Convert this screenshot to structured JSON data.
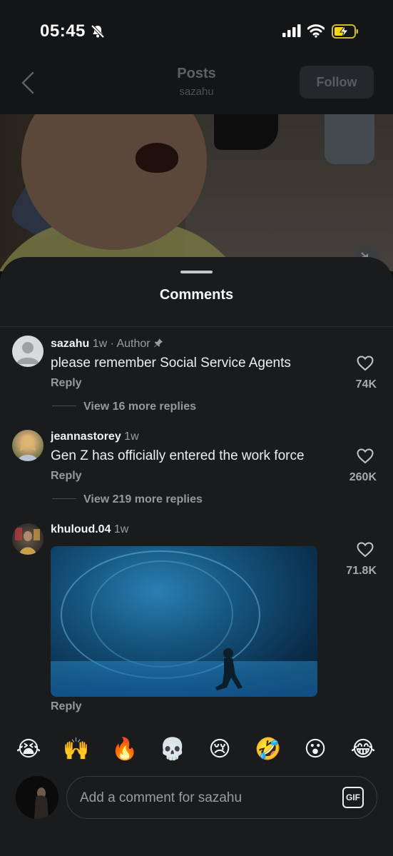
{
  "status_bar": {
    "time": "05:45"
  },
  "header": {
    "title": "Posts",
    "subtitle": "sazahu",
    "follow_label": "Follow"
  },
  "sheet": {
    "title": "Comments"
  },
  "comments": [
    {
      "username": "sazahu",
      "meta": " 1w · Author",
      "pinned": true,
      "text": "please remember Social Service Agents",
      "reply_label": "Reply",
      "view_replies": "View 16 more replies",
      "likes": "74K"
    },
    {
      "username": "jeannastorey",
      "meta": " 1w",
      "text": "Gen Z has officially entered the work force",
      "reply_label": "Reply",
      "view_replies": "View 219 more replies",
      "likes": "260K"
    },
    {
      "username": "khuloud.04",
      "meta": " 1w",
      "media": "gif-underwater-diver",
      "reply_label": "Reply",
      "likes": "71.8K"
    }
  ],
  "emojis": [
    "😭",
    "🙌",
    "🔥",
    "💀",
    "😢",
    "🤣",
    "😮",
    "😂"
  ],
  "composer": {
    "placeholder": "Add a comment for sazahu",
    "gif_label": "GIF"
  },
  "colors": {
    "background": "#1a1b1d",
    "text": "#f2f3f5",
    "muted": "#96989c"
  }
}
